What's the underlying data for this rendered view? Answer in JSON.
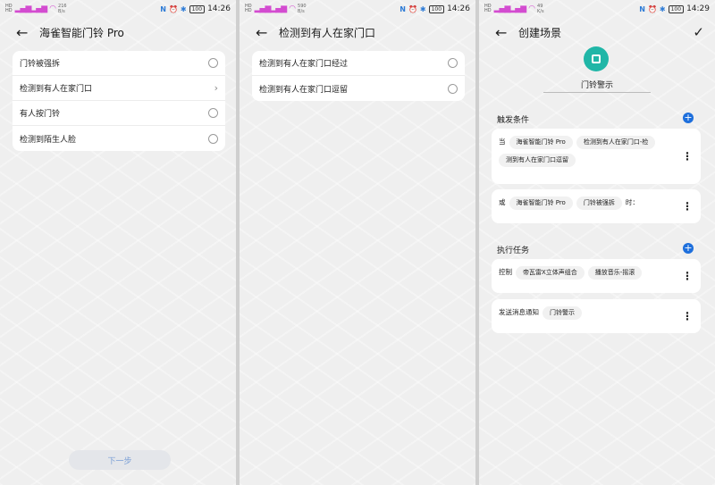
{
  "status_left": {
    "panel1": {
      "hd1": "HD",
      "hd2": "HD",
      "speed_num": "216",
      "speed_unit": "B/s"
    },
    "panel2": {
      "hd1": "HD",
      "hd2": "HD",
      "speed_num": "590",
      "speed_unit": "B/s"
    },
    "panel3": {
      "hd1": "HD",
      "hd2": "HD",
      "speed_num": "49",
      "speed_unit": "K/s"
    }
  },
  "status_right": {
    "nfc": "N",
    "battery": "100",
    "time1": "14:26",
    "time2": "14:26",
    "time3": "14:29"
  },
  "panel1": {
    "title": "海雀智能门铃 Pro",
    "options": [
      "门铃被强拆",
      "检测到有人在家门口",
      "有人按门铃",
      "检测到陌生人脸"
    ],
    "next_button": "下一步"
  },
  "panel2": {
    "title": "检测到有人在家门口",
    "options": [
      "检测到有人在家门口经过",
      "检测到有人在家门口逗留"
    ]
  },
  "panel3": {
    "title": "创建场景",
    "scene_name": "门铃警示",
    "trigger_section": "触发条件",
    "trigger1": {
      "prefix": "当",
      "device": "海雀智能门铃 Pro",
      "event": "检测到有人在家门口-检",
      "event_cont": "测到有人在家门口逗留"
    },
    "trigger2": {
      "prefix": "或",
      "device": "海雀智能门铃 Pro",
      "event": "门铃被强拆",
      "suffix": "时："
    },
    "task_section": "执行任务",
    "task1": {
      "prefix": "控制",
      "device": "帝瓦雷X立体声组合",
      "action": "播放音乐-摇滚"
    },
    "task2": {
      "prefix": "发送消息通知",
      "content": "门铃警示"
    }
  },
  "colors": {
    "accent": "#1e6fdc",
    "scene_icon": "#20b6a7",
    "next_text": "#7a9fd6"
  }
}
